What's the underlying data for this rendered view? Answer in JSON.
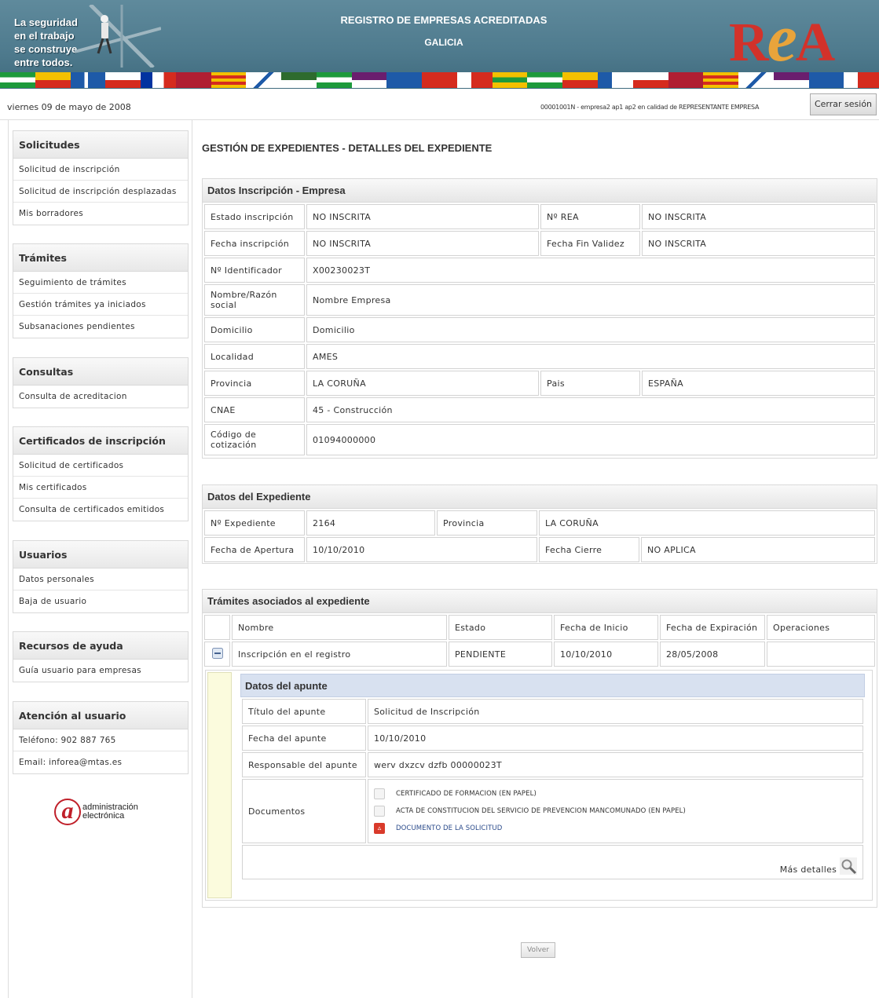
{
  "banner": {
    "slogan_line1": "La seguridad",
    "slogan_line2": "en el trabajo",
    "slogan_line3": "se construye",
    "slogan_line4": "entre todos.",
    "title": "REGISTRO DE EMPRESAS ACREDITADAS",
    "subtitle": "GALICIA",
    "logo_r": "R",
    "logo_e": "e",
    "logo_a": "A"
  },
  "topbar": {
    "date": "viernes 09 de mayo de 2008",
    "user_info": "00001001N - empresa2 ap1 ap2 en calidad de REPRESENTANTE EMPRESA",
    "logout_label": "Cerrar sesión"
  },
  "sidebar": {
    "solicitudes": {
      "title": "Solicitudes",
      "items": [
        "Solicitud de inscripción",
        "Solicitud de inscripción desplazadas",
        "Mis borradores"
      ]
    },
    "tramites": {
      "title": "Trámites",
      "items": [
        "Seguimiento de trámites",
        "Gestión trámites ya iniciados",
        "Subsanaciones pendientes"
      ]
    },
    "consultas": {
      "title": "Consultas",
      "items": [
        "Consulta de acreditacion"
      ]
    },
    "certificados": {
      "title": "Certificados de inscripción",
      "items": [
        "Solicitud de certificados",
        "Mis certificados",
        "Consulta de certificados emitidos"
      ]
    },
    "usuarios": {
      "title": "Usuarios",
      "items": [
        "Datos personales",
        "Baja de usuario"
      ]
    },
    "ayuda": {
      "title": "Recursos de ayuda",
      "items": [
        "Guía usuario para empresas"
      ]
    },
    "atencion": {
      "title": "Atención al usuario",
      "items": [
        "Teléfono: 902 887 765",
        "Email: inforea@mtas.es"
      ]
    },
    "logo": {
      "symbol": "a",
      "line1": "administración",
      "line2": "electrónica"
    }
  },
  "main": {
    "page_title": "GESTIÓN DE EXPEDIENTES - DETALLES DEL EXPEDIENTE",
    "inscripcion": {
      "title": "Datos Inscripción - Empresa",
      "estado_label": "Estado inscripción",
      "estado_value": "NO INSCRITA",
      "nrea_label": "Nº REA",
      "nrea_value": "NO INSCRITA",
      "fecha_label": "Fecha inscripción",
      "fecha_value": "NO INSCRITA",
      "fin_label": "Fecha Fin Validez",
      "fin_value": "NO INSCRITA",
      "id_label": "Nº Identificador",
      "id_value": "X00230023T",
      "nombre_label": "Nombre/Razón social",
      "nombre_value": "Nombre Empresa",
      "domicilio_label": "Domicilio",
      "domicilio_value": "Domicilio",
      "localidad_label": "Localidad",
      "localidad_value": "AMES",
      "provincia_label": "Provincia",
      "provincia_value": "LA CORUÑA",
      "pais_label": "Pais",
      "pais_value": "ESPAÑA",
      "cnae_label": "CNAE",
      "cnae_value": "45 -  Construcción",
      "cotizacion_label": "Código de cotización",
      "cotizacion_value": "01094000000"
    },
    "expediente": {
      "title": "Datos del Expediente",
      "num_label": "Nº Expediente",
      "num_value": "2164",
      "prov_label": "Provincia",
      "prov_value": "LA CORUÑA",
      "apertura_label": "Fecha de Apertura",
      "apertura_value": "10/10/2010",
      "cierre_label": "Fecha Cierre",
      "cierre_value": "NO APLICA"
    },
    "tramites": {
      "title": "Trámites asociados al expediente",
      "columns": [
        "Nombre",
        "Estado",
        "Fecha de Inicio",
        "Fecha de Expiración",
        "Operaciones"
      ],
      "row": {
        "nombre": "Inscripción en el registro",
        "estado": "PENDIENTE",
        "inicio": "10/10/2010",
        "expiracion": "28/05/2008",
        "operaciones": ""
      }
    },
    "apunte": {
      "title": "Datos del apunte",
      "titulo_label": "Título del apunte",
      "titulo_value": "Solicitud de Inscripción",
      "fecha_label": "Fecha del apunte",
      "fecha_value": "10/10/2010",
      "resp_label": "Responsable del apunte",
      "resp_value": "werv dxzcv dzfb 00000023T",
      "docs_label": "Documentos",
      "docs": [
        {
          "name": "CERTIFICADO DE FORMACION  (EN PAPEL)",
          "icon": "blank-doc-icon"
        },
        {
          "name": "ACTA DE CONSTITUCION DEL SERVICIO DE PREVENCION MANCOMUNADO  (EN PAPEL)",
          "icon": "blank-doc-icon"
        },
        {
          "name": "DOCUMENTO DE LA SOLICITUD",
          "icon": "pdf-icon"
        }
      ],
      "mas_detalles": "Más detalles"
    },
    "volver_label": "Volver"
  },
  "colors": {
    "banner": "#4e7a8d",
    "accent_red": "#d2322a",
    "accent_orange": "#e9a43b",
    "apunte_header": "#d8e1f0",
    "yellow_strip": "#fbfbdd"
  }
}
